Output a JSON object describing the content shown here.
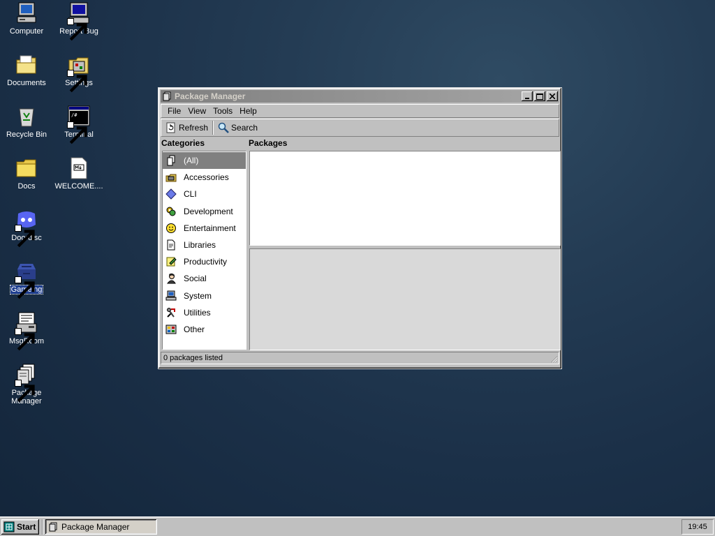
{
  "desktop": {
    "icons": [
      {
        "label": "Computer",
        "icon": "computer-icon"
      },
      {
        "label": "Report Bug",
        "icon": "report-bug-icon"
      },
      {
        "label": "Documents",
        "icon": "documents-folder-icon"
      },
      {
        "label": "Settings",
        "icon": "settings-icon"
      },
      {
        "label": "Recycle Bin",
        "icon": "recycle-bin-icon"
      },
      {
        "label": "Terminal",
        "icon": "terminal-icon"
      },
      {
        "label": "Docs",
        "icon": "folder-icon"
      },
      {
        "label": "WELCOME....",
        "icon": "markdown-file-icon"
      },
      {
        "label": "Doordisc",
        "icon": "doordisc-icon"
      },
      {
        "label": "Gameing",
        "icon": "gameing-icon"
      },
      {
        "label": "MsgRoom",
        "icon": "msgroom-icon"
      },
      {
        "label": "Package Manager",
        "icon": "package-manager-icon"
      }
    ]
  },
  "window": {
    "title": "Package Manager",
    "menu": [
      "File",
      "View",
      "Tools",
      "Help"
    ],
    "toolbar": {
      "refresh_label": "Refresh",
      "search_label": "Search"
    },
    "categories_header": "Categories",
    "packages_header": "Packages",
    "categories": [
      {
        "label": "(All)",
        "icon": "all-icon",
        "selected": true
      },
      {
        "label": "Accessories",
        "icon": "accessories-icon"
      },
      {
        "label": "CLI",
        "icon": "cli-icon"
      },
      {
        "label": "Development",
        "icon": "development-icon"
      },
      {
        "label": "Entertainment",
        "icon": "entertainment-icon"
      },
      {
        "label": "Libraries",
        "icon": "libraries-icon"
      },
      {
        "label": "Productivity",
        "icon": "productivity-icon"
      },
      {
        "label": "Social",
        "icon": "social-icon"
      },
      {
        "label": "System",
        "icon": "system-icon"
      },
      {
        "label": "Utilities",
        "icon": "utilities-icon"
      },
      {
        "label": "Other",
        "icon": "other-icon"
      }
    ],
    "status": "0 packages listed"
  },
  "taskbar": {
    "start_label": "Start",
    "task_label": "Package Manager",
    "clock": "19:45"
  }
}
